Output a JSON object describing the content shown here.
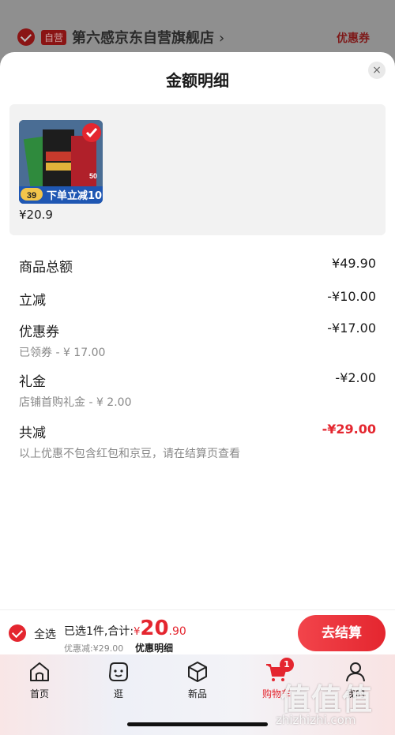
{
  "background": {
    "store_tag": "自营",
    "store_name": "第六感京东自营旗舰店",
    "chevron": "›",
    "coupon_label": "优惠券"
  },
  "sheet": {
    "title": "金额明细",
    "close_icon": "×",
    "product": {
      "price": "¥20.9",
      "image_text": {
        "promo": "下单立减10",
        "price_badge": "39",
        "count_badge": "50"
      }
    },
    "rows": [
      {
        "label": "商品总额",
        "value": "¥49.90",
        "sub": ""
      },
      {
        "label": "立减",
        "value": "-¥10.00",
        "sub": ""
      },
      {
        "label": "优惠券",
        "value": "-¥17.00",
        "sub": "已领券 - ¥ 17.00"
      },
      {
        "label": "礼金",
        "value": "-¥2.00",
        "sub": "店铺首购礼金 - ¥ 2.00"
      },
      {
        "label": "共减",
        "value": "-¥29.00",
        "sub": "以上优惠不包含红包和京豆，请在结算页查看"
      }
    ]
  },
  "bottom_bar": {
    "select_all": "全选",
    "summary_prefix": "已选1件,合计:",
    "total_symbol": "¥",
    "total_int": "20",
    "total_dec": ".90",
    "discount": "优惠减:¥29.00",
    "detail_link": "优惠明细",
    "checkout": "去结算"
  },
  "tabbar": {
    "items": [
      {
        "label": "首页",
        "icon": "home-icon"
      },
      {
        "label": "逛",
        "icon": "face-icon"
      },
      {
        "label": "新品",
        "icon": "cube-icon"
      },
      {
        "label": "购物车",
        "icon": "cart-icon",
        "badge": "1",
        "active": true
      },
      {
        "label": "我的",
        "icon": "person-icon"
      }
    ]
  },
  "watermark": {
    "text": "值值值",
    "url": "zhizhizhi.com"
  },
  "colors": {
    "accent": "#e4262f",
    "text": "#1a1a1a",
    "muted": "#888888"
  }
}
